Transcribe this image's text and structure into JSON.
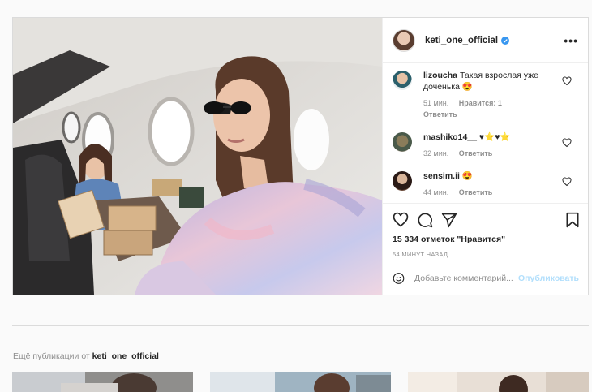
{
  "post": {
    "username": "keti_one_official",
    "more_label": "•••",
    "comments": [
      {
        "user": "lizoucha",
        "text": "Такая взрослая уже доченька 😍",
        "time": "51 мин.",
        "likes": "Нравится: 1",
        "reply": "Ответить"
      },
      {
        "user": "mashiko14__",
        "text": "♥⭐♥⭐",
        "time": "32 мин.",
        "likes": "",
        "reply": "Ответить"
      },
      {
        "user": "sensim.ii",
        "text": "😍",
        "time": "44 мин.",
        "likes": "",
        "reply": "Ответить"
      }
    ],
    "likes_text": "15 334 отметок \"Нравится\"",
    "time_ago": "54 МИНУТ НАЗАД",
    "comment_placeholder": "Добавьте комментарий...",
    "publish_label": "Опубликовать"
  },
  "more_from": {
    "prefix": "Ещё публикации от",
    "username": "keti_one_official"
  },
  "colors": {
    "accent": "#0095f6",
    "publish_disabled": "#b2dffc",
    "text": "#262626",
    "muted": "#8e8e8e"
  },
  "icons": [
    "verified-badge-icon",
    "heart-icon",
    "comment-icon",
    "share-icon",
    "bookmark-icon",
    "emoji-icon"
  ]
}
